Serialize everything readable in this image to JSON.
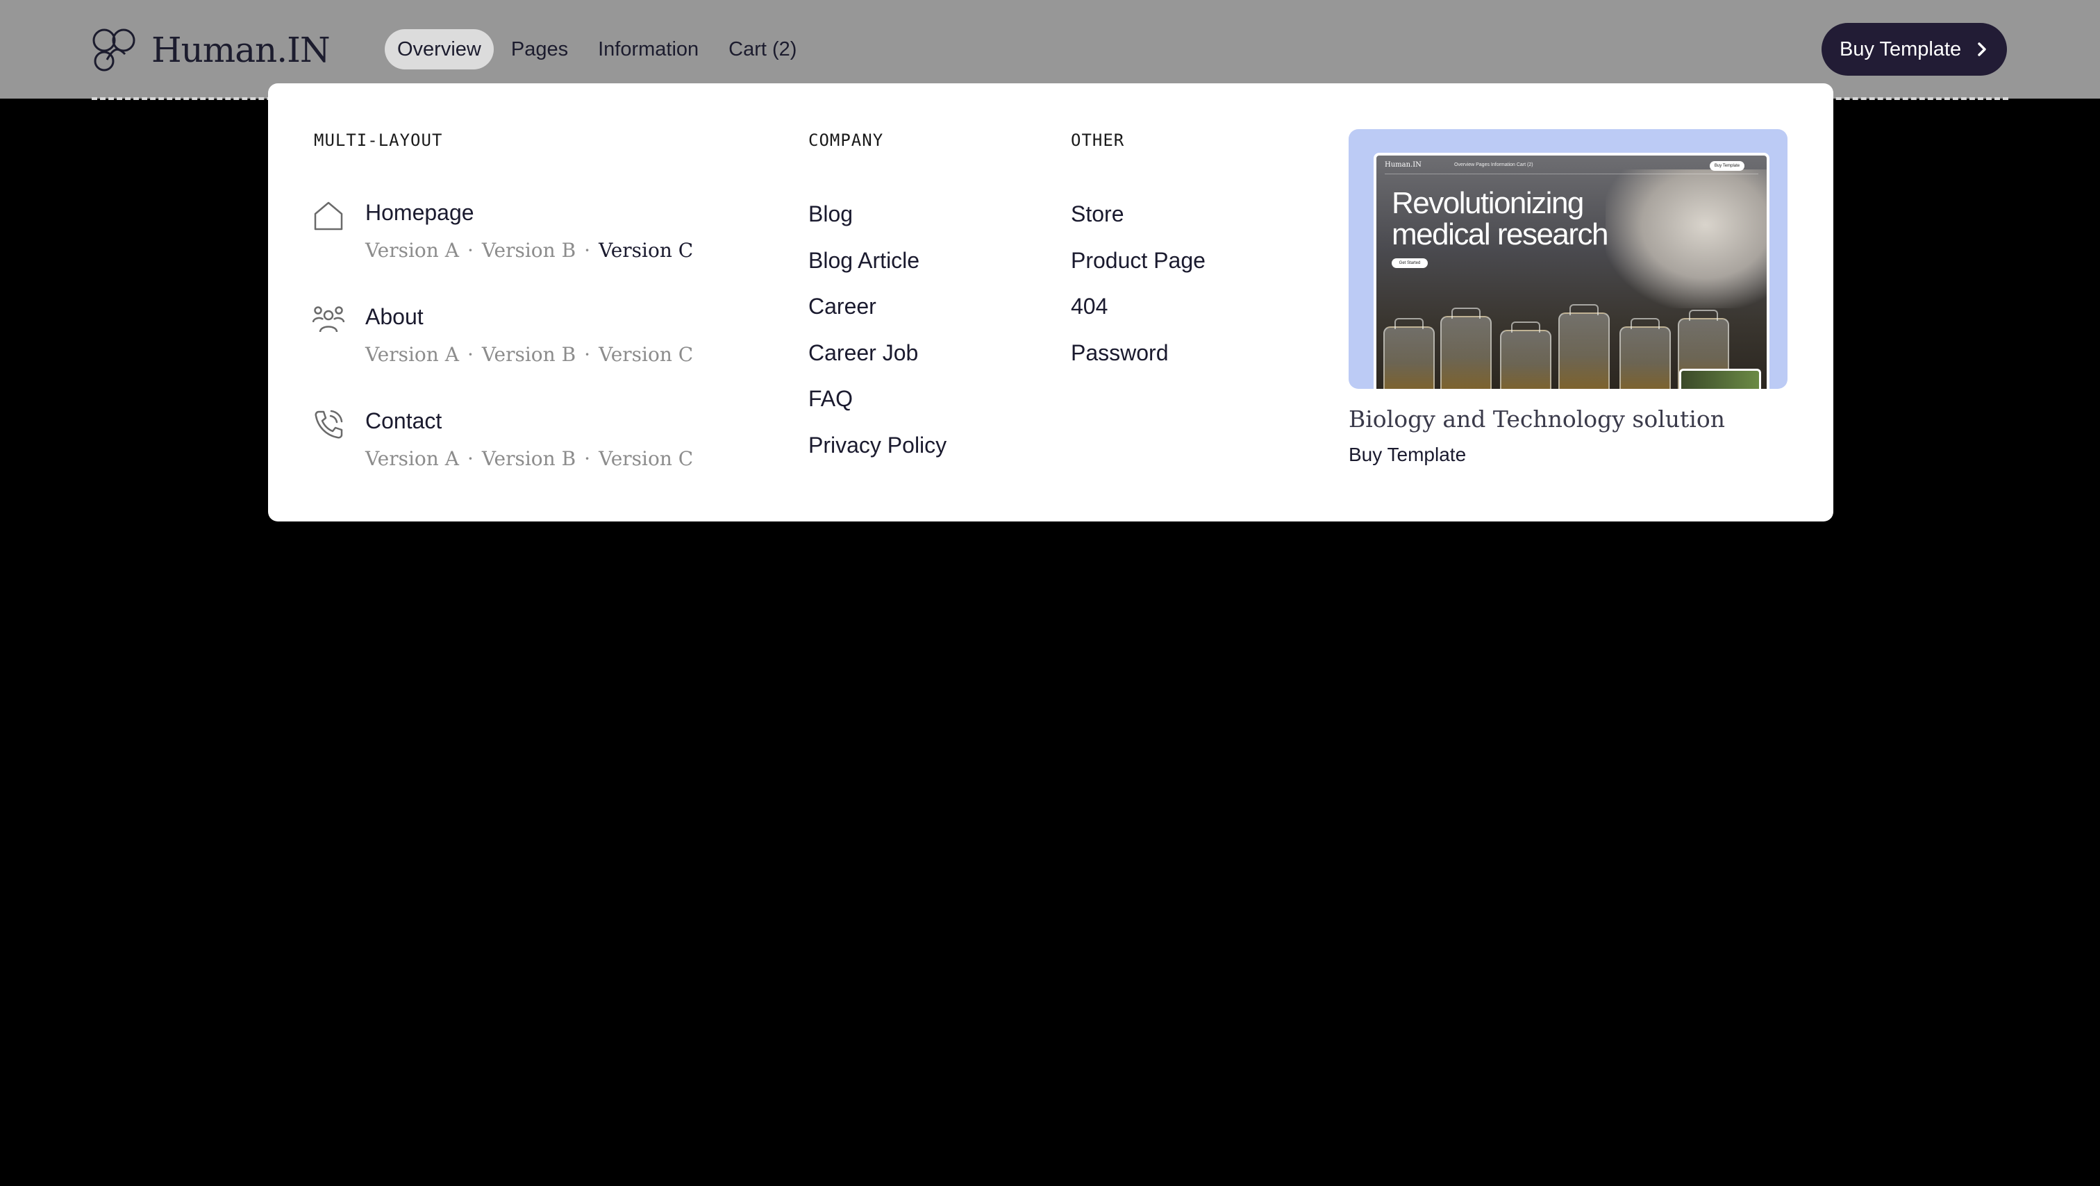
{
  "header": {
    "logo_text": "Human.IN",
    "nav": [
      {
        "label": "Overview",
        "active": true
      },
      {
        "label": "Pages",
        "active": false
      },
      {
        "label": "Information",
        "active": false
      },
      {
        "label": "Cart (2)",
        "active": false
      }
    ],
    "buy_button": "Buy Template"
  },
  "dropdown": {
    "multi_layout": {
      "heading": "MULTI-LAYOUT",
      "items": [
        {
          "title": "Homepage",
          "icon": "home-icon",
          "versions": [
            "Version A",
            "Version B",
            "Version C"
          ],
          "current": "Version C"
        },
        {
          "title": "About",
          "icon": "users-icon",
          "versions": [
            "Version A",
            "Version B",
            "Version C"
          ],
          "current": ""
        },
        {
          "title": "Contact",
          "icon": "phone-icon",
          "versions": [
            "Version A",
            "Version B",
            "Version C"
          ],
          "current": ""
        }
      ],
      "separator": "·"
    },
    "company": {
      "heading": "COMPANY",
      "links": [
        "Blog",
        "Blog Article",
        "Career",
        "Career Job",
        "FAQ",
        "Privacy Policy"
      ]
    },
    "other": {
      "heading": "OTHER",
      "links": [
        "Store",
        "Product Page",
        "404",
        "Password"
      ]
    },
    "promo": {
      "preview": {
        "logo": "Human.IN",
        "nav": "Overview   Pages   Information   Cart (2)",
        "button": "Buy Template",
        "headline": "Revolutionizing medical research",
        "cta": "Get Started"
      },
      "title": "Biology and Technology solution",
      "link": "Buy Template"
    }
  },
  "colors": {
    "header_bg": "#979797",
    "page_bg": "#000000",
    "button_bg": "#221c35",
    "promo_bg": "#bccbf5",
    "active_nav_bg": "#dcdcdc"
  }
}
